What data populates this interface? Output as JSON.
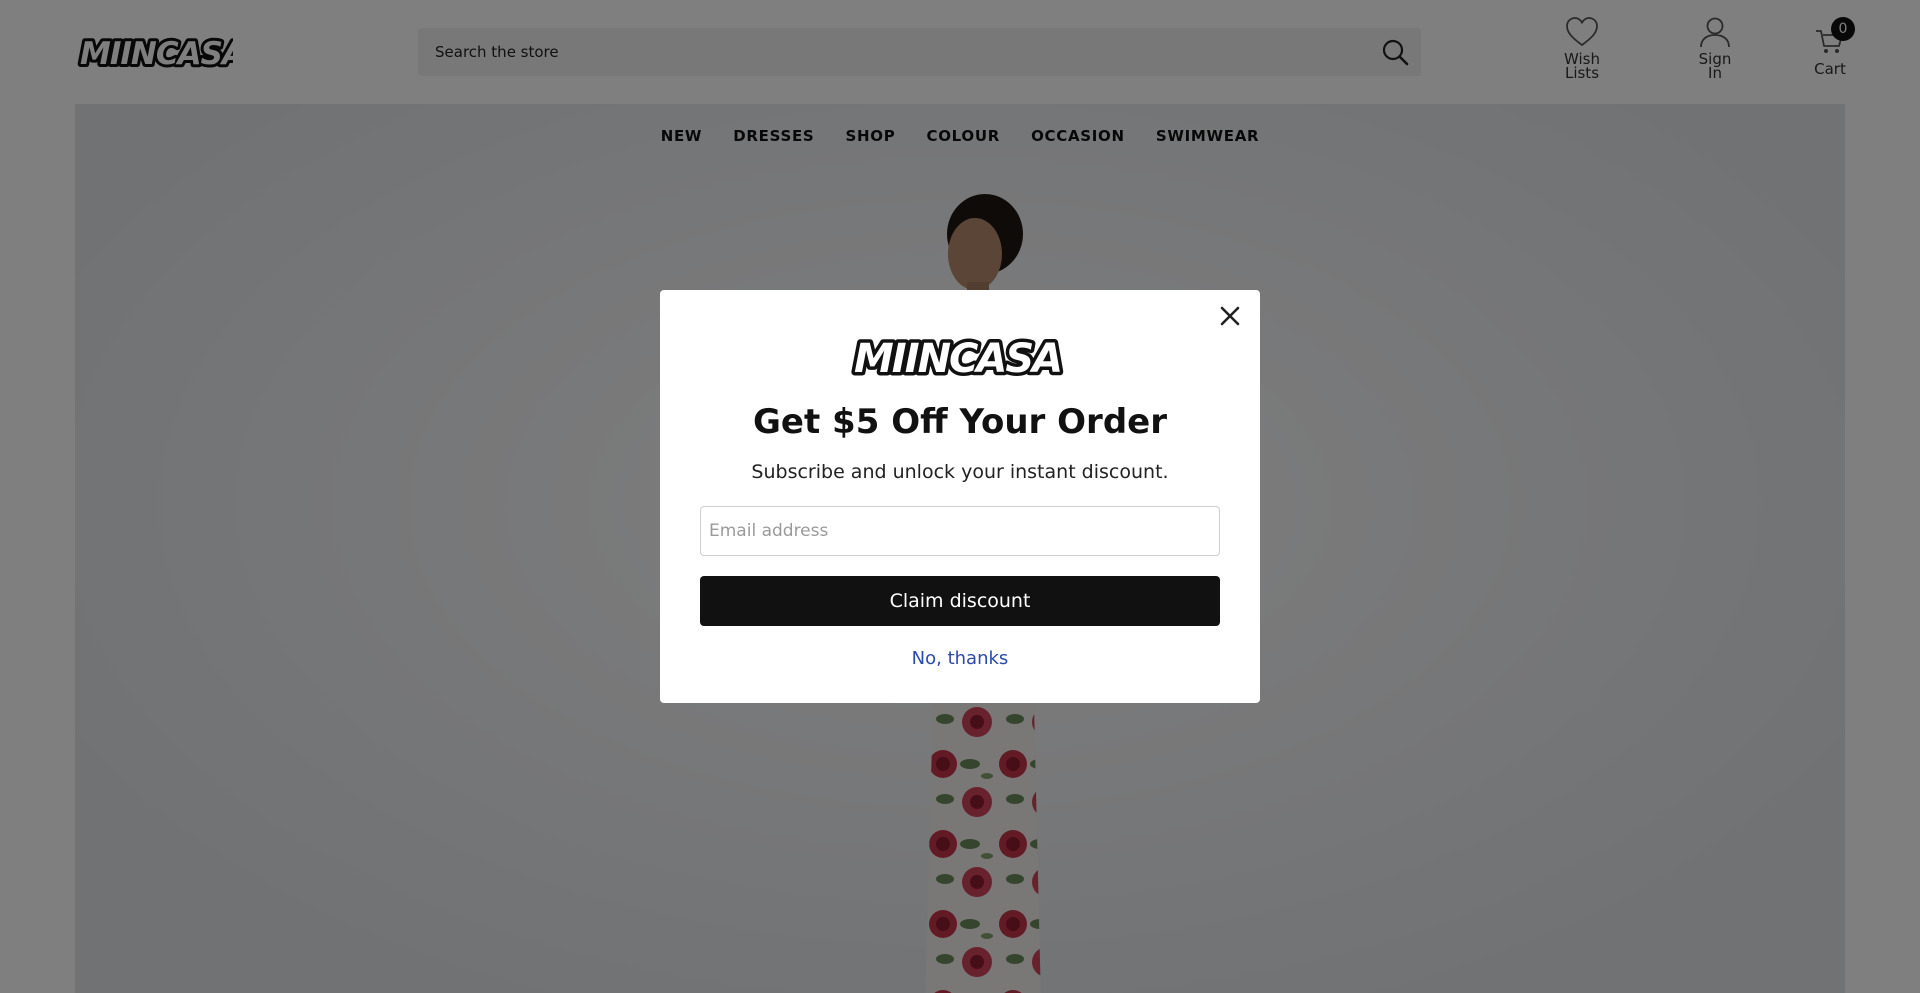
{
  "header": {
    "logo_text": "MIINCASA",
    "search_placeholder": "Search the store",
    "wishlist_label_line1": "Wish",
    "wishlist_label_line2": "Lists",
    "signin_label_line1": "Sign",
    "signin_label_line2": "In",
    "cart_label": "Cart",
    "cart_count": "0"
  },
  "nav": {
    "items": [
      "NEW",
      "DRESSES",
      "SHOP",
      "COLOUR",
      "OCCASION",
      "SWIMWEAR"
    ]
  },
  "modal": {
    "logo_text": "MIINCASA",
    "title": "Get $5 Off Your Order",
    "subtitle": "Subscribe and unlock your instant discount.",
    "email_placeholder": "Email address",
    "email_value": "",
    "claim_label": "Claim discount",
    "dismiss_label": "No, thanks"
  },
  "colors": {
    "overlay": "rgba(0,0,0,0.5)",
    "button_bg": "#111111",
    "dismiss_link": "#2c4aa8",
    "search_bg": "#f1f1f1"
  },
  "icons": {
    "search": "search-icon",
    "wishlist": "heart-icon",
    "signin": "user-icon",
    "cart": "cart-icon",
    "close": "close-icon"
  }
}
